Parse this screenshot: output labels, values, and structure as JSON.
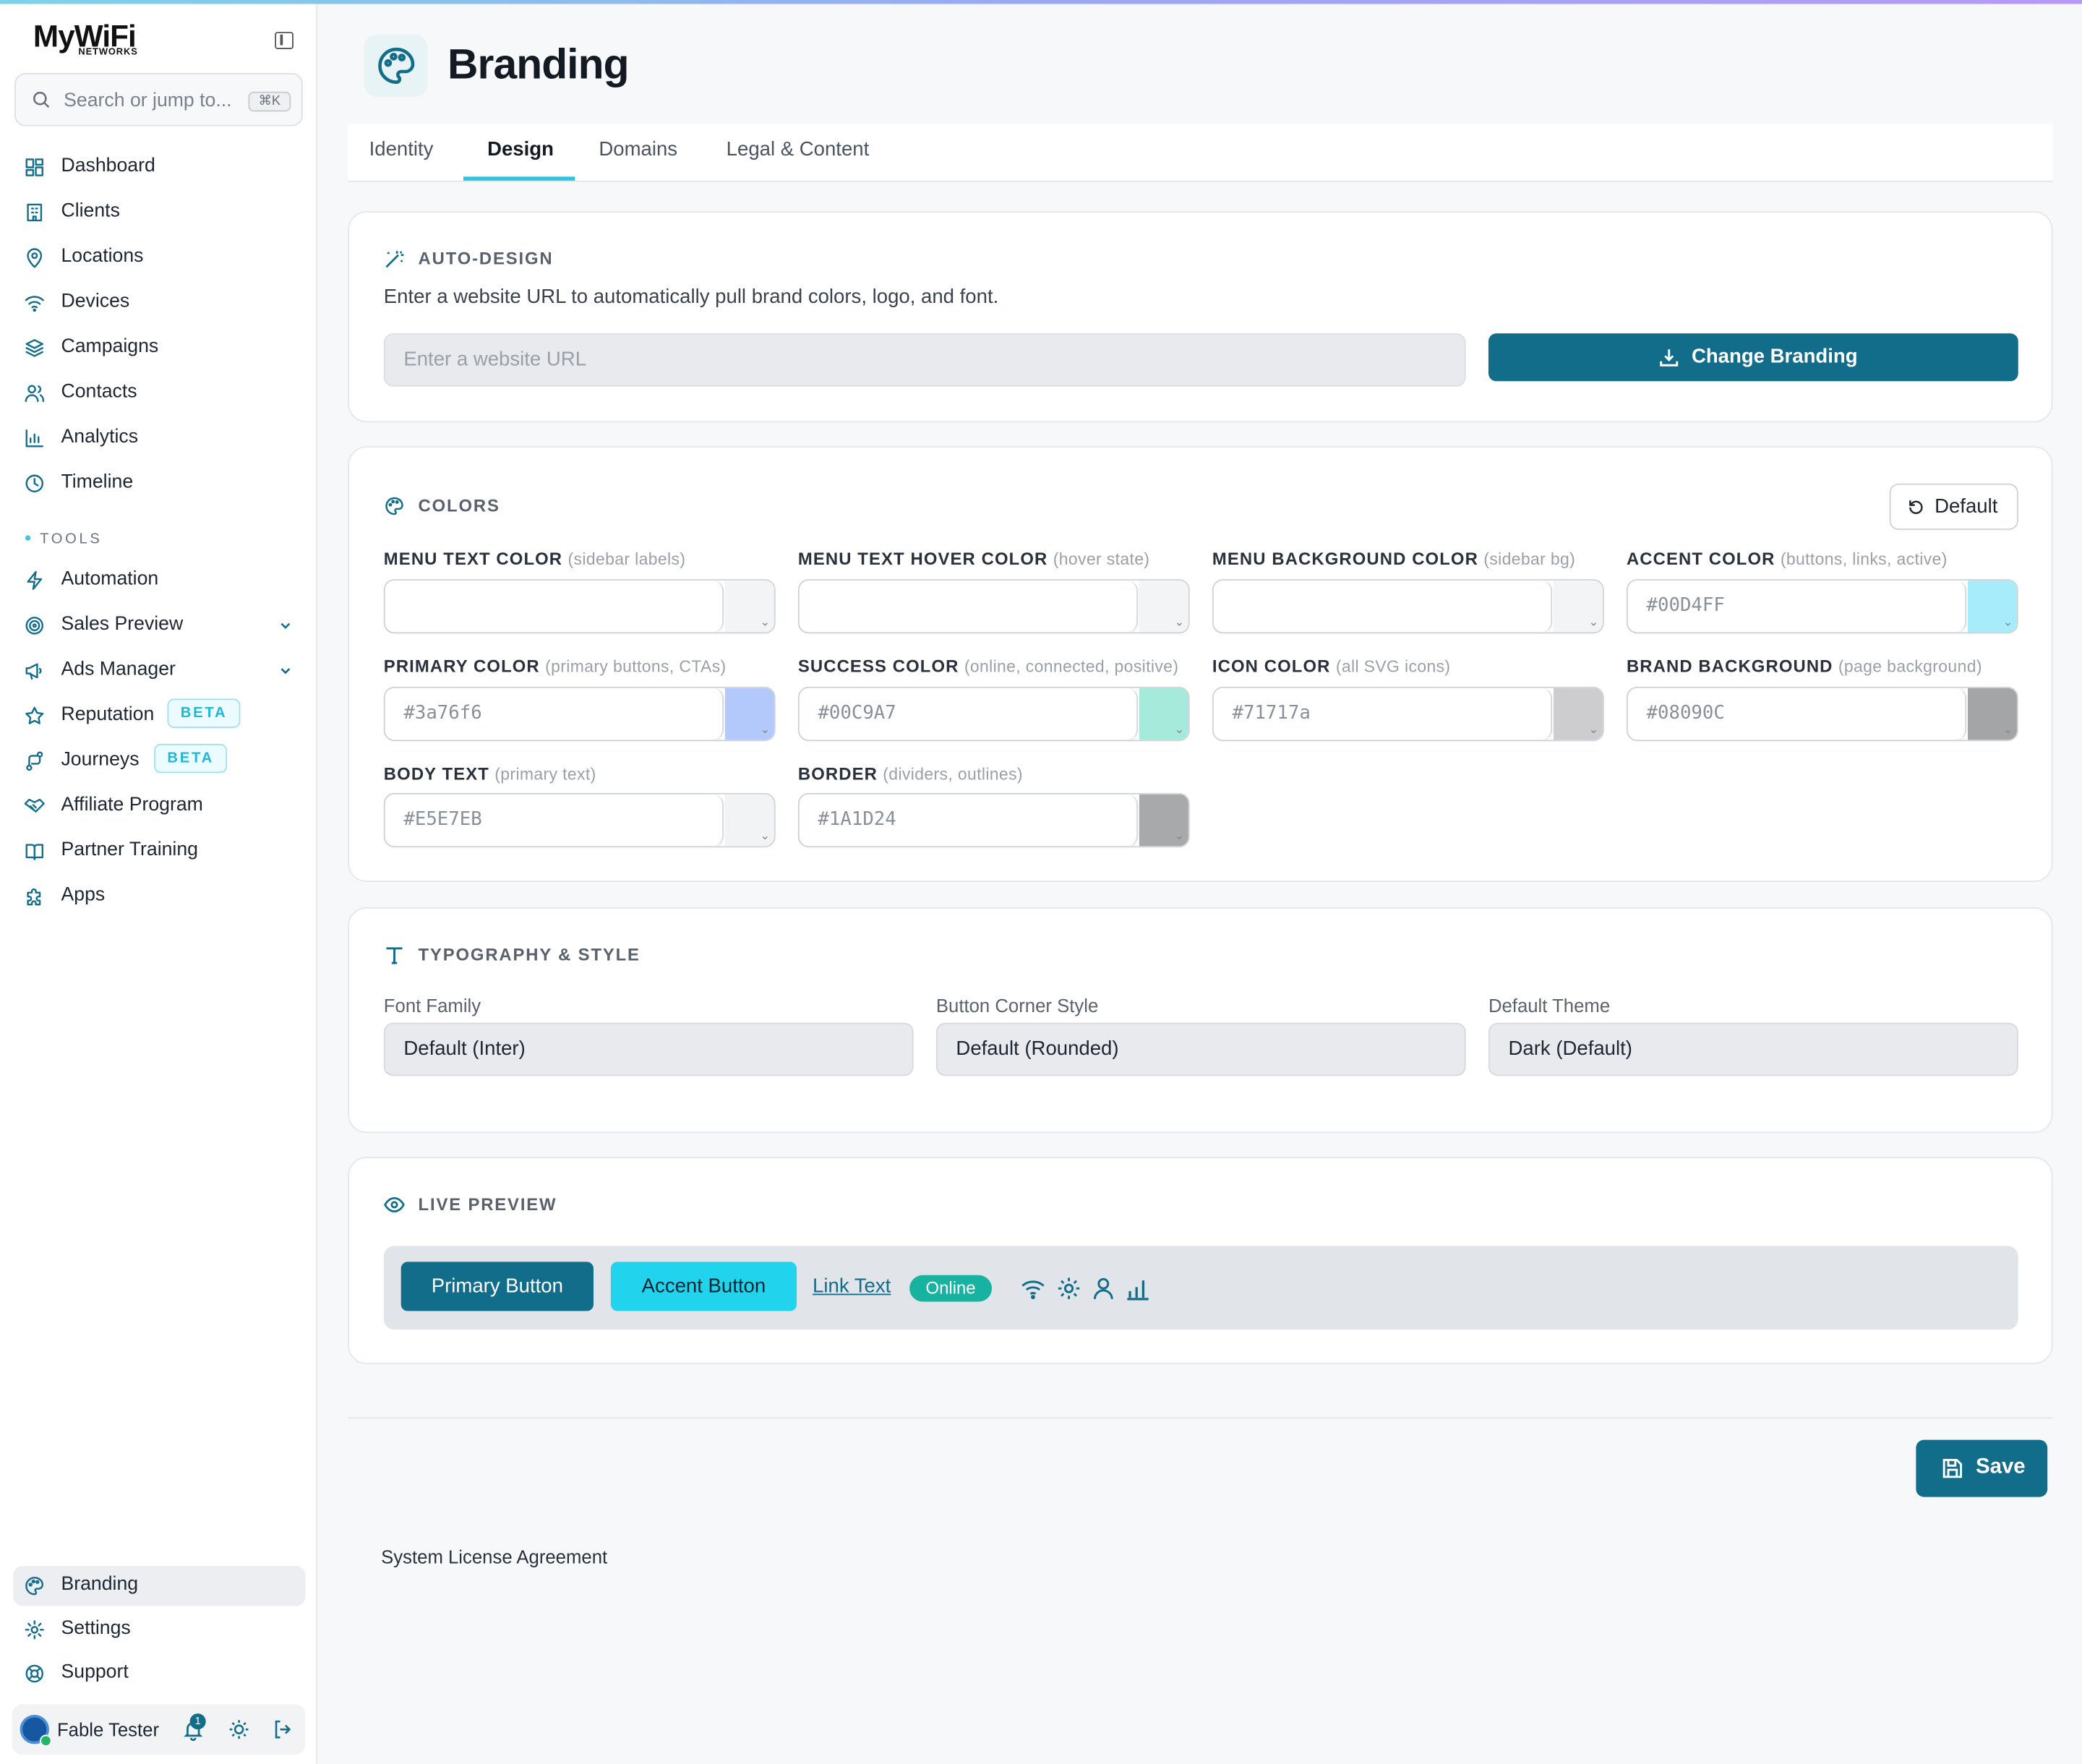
{
  "brand": {
    "logo_text": "MyWiFi",
    "logo_sub": "NETWORKS"
  },
  "search": {
    "placeholder": "Search or jump to...",
    "shortcut": "⌘K"
  },
  "nav": {
    "items": [
      {
        "label": "Dashboard",
        "icon": "dashboard-icon"
      },
      {
        "label": "Clients",
        "icon": "building-icon"
      },
      {
        "label": "Locations",
        "icon": "map-pin-icon"
      },
      {
        "label": "Devices",
        "icon": "wifi-icon"
      },
      {
        "label": "Campaigns",
        "icon": "layers-icon"
      },
      {
        "label": "Contacts",
        "icon": "users-icon"
      },
      {
        "label": "Analytics",
        "icon": "bar-chart-icon"
      },
      {
        "label": "Timeline",
        "icon": "clock-icon"
      }
    ],
    "tools_heading": "TOOLS",
    "tools": [
      {
        "label": "Automation",
        "icon": "zap-icon"
      },
      {
        "label": "Sales Preview",
        "icon": "target-icon"
      },
      {
        "label": "Ads Manager",
        "icon": "megaphone-icon"
      },
      {
        "label": "Reputation",
        "icon": "star-icon",
        "badge": "BETA"
      },
      {
        "label": "Journeys",
        "icon": "route-icon",
        "badge": "BETA"
      },
      {
        "label": "Affiliate Program",
        "icon": "handshake-icon"
      },
      {
        "label": "Partner Training",
        "icon": "book-icon"
      },
      {
        "label": "Apps",
        "icon": "puzzle-icon"
      }
    ],
    "bottom": [
      {
        "label": "Branding",
        "icon": "palette-icon",
        "active": true
      },
      {
        "label": "Settings",
        "icon": "gear-icon"
      },
      {
        "label": "Support",
        "icon": "lifebuoy-icon"
      }
    ]
  },
  "user": {
    "name": "Fable Tester",
    "notifications": "1"
  },
  "page": {
    "title": "Branding"
  },
  "tabs": [
    {
      "label": "Identity"
    },
    {
      "label": "Design",
      "active": true
    },
    {
      "label": "Domains"
    },
    {
      "label": "Legal & Content"
    }
  ],
  "auto_design": {
    "heading": "AUTO-DESIGN",
    "description": "Enter a website URL to automatically pull brand colors, logo, and font.",
    "url_placeholder": "Enter a website URL",
    "button": "Change Branding"
  },
  "colors": {
    "heading": "COLORS",
    "default_button": "Default",
    "fields": [
      {
        "label": "MENU TEXT COLOR",
        "hint": "(sidebar labels)",
        "value": "",
        "swatch": "#f3f4f6"
      },
      {
        "label": "MENU TEXT HOVER COLOR",
        "hint": "(hover state)",
        "value": "",
        "swatch": "#f3f4f6"
      },
      {
        "label": "MENU BACKGROUND COLOR",
        "hint": "(sidebar bg)",
        "value": "",
        "swatch": "#f3f4f6"
      },
      {
        "label": "ACCENT COLOR",
        "hint": "(buttons, links, active)",
        "value": "#00D4FF",
        "swatch": "#a6ecfa"
      },
      {
        "label": "PRIMARY COLOR",
        "hint": "(primary buttons, CTAs)",
        "value": "#3a76f6",
        "swatch": "#b3c9fb"
      },
      {
        "label": "SUCCESS COLOR",
        "hint": "(online, connected, positive)",
        "value": "#00C9A7",
        "swatch": "#a6eadc"
      },
      {
        "label": "ICON COLOR",
        "hint": "(all SVG icons)",
        "value": "#71717a",
        "swatch": "#cdcdd0"
      },
      {
        "label": "BRAND BACKGROUND",
        "hint": "(page background)",
        "value": "#08090C",
        "swatch": "#a4a5a6"
      },
      {
        "label": "BODY TEXT",
        "hint": "(primary text)",
        "value": "#E5E7EB",
        "swatch": "#f2f3f5"
      },
      {
        "label": "BORDER",
        "hint": "(dividers, outlines)",
        "value": "#1A1D24",
        "swatch": "#a8a9ab"
      }
    ]
  },
  "typography": {
    "heading": "TYPOGRAPHY & STYLE",
    "fields": [
      {
        "label": "Font Family",
        "value": "Default (Inter)"
      },
      {
        "label": "Button Corner Style",
        "value": "Default (Rounded)"
      },
      {
        "label": "Default Theme",
        "value": "Dark (Default)"
      }
    ]
  },
  "preview": {
    "heading": "LIVE PREVIEW",
    "primary_button": "Primary Button",
    "accent_button": "Accent Button",
    "link_text": "Link Text",
    "status": "Online",
    "primary_color": "#126d8b",
    "accent_color": "#22d3ee",
    "success_color": "#18b3a0"
  },
  "footer": {
    "save": "Save",
    "license": "System License Agreement"
  }
}
